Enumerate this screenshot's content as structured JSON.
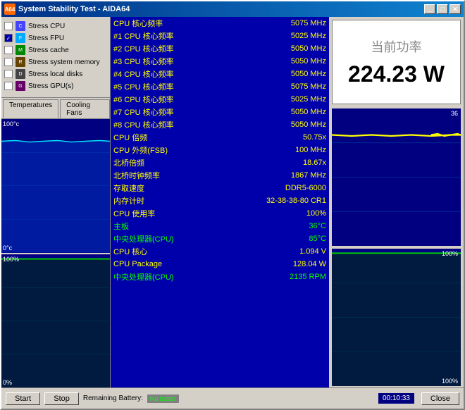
{
  "window": {
    "title": "System Stability Test - AIDA64",
    "icon": "A64"
  },
  "stress_options": [
    {
      "label": "Stress CPU",
      "checked": false,
      "icon": "cpu"
    },
    {
      "label": "Stress FPU",
      "checked": true,
      "icon": "fpu"
    },
    {
      "label": "Stress cache",
      "checked": false,
      "icon": "cache"
    },
    {
      "label": "Stress system memory",
      "checked": false,
      "icon": "mem"
    },
    {
      "label": "Stress local disks",
      "checked": false,
      "icon": "disk"
    },
    {
      "label": "Stress GPU(s)",
      "checked": false,
      "icon": "gpu"
    }
  ],
  "tabs": [
    {
      "label": "Temperatures",
      "active": true
    },
    {
      "label": "Cooling Fans",
      "active": false
    }
  ],
  "chart_left_top": {
    "top_label": "100°c",
    "bottom_label": "0°c"
  },
  "chart_left_bottom": {
    "top_label": "100%",
    "bottom_label": "0%"
  },
  "cpu_data": [
    {
      "label": "CPU 核心频率",
      "value": "5075 MHz",
      "style": "yellow"
    },
    {
      "label": "#1 CPU 核心频率",
      "value": "5025 MHz",
      "style": "yellow"
    },
    {
      "label": "#2 CPU 核心频率",
      "value": "5050 MHz",
      "style": "yellow"
    },
    {
      "label": "#3 CPU 核心频率",
      "value": "5050 MHz",
      "style": "yellow"
    },
    {
      "label": "#4 CPU 核心频率",
      "value": "5050 MHz",
      "style": "yellow"
    },
    {
      "label": "#5 CPU 核心频率",
      "value": "5075 MHz",
      "style": "yellow"
    },
    {
      "label": "#6 CPU 核心频率",
      "value": "5025 MHz",
      "style": "yellow"
    },
    {
      "label": "#7 CPU 核心频率",
      "value": "5050 MHz",
      "style": "yellow"
    },
    {
      "label": "#8 CPU 核心频率",
      "value": "5050 MHz",
      "style": "yellow"
    },
    {
      "label": "CPU 倍频",
      "value": "50.75x",
      "style": "yellow"
    },
    {
      "label": "CPU 外频(FSB)",
      "value": "100 MHz",
      "style": "yellow"
    },
    {
      "label": "北桥倍频",
      "value": "18.67x",
      "style": "yellow"
    },
    {
      "label": "北桥时钟频率",
      "value": "1867 MHz",
      "style": "yellow"
    },
    {
      "label": "存取速度",
      "value": "DDR5-6000",
      "style": "yellow"
    },
    {
      "label": "内存计时",
      "value": "32-38-38-80 CR1",
      "style": "yellow"
    },
    {
      "label": "CPU 使用率",
      "value": "100%",
      "style": "yellow"
    },
    {
      "label": "主板",
      "value": "36°C",
      "style": "green"
    },
    {
      "label": "中央处理器(CPU)",
      "value": "85°C",
      "style": "green"
    },
    {
      "label": "CPU 核心",
      "value": "1.094 V",
      "style": "yellow"
    },
    {
      "label": "CPU Package",
      "value": "128.04 W",
      "style": "yellow"
    },
    {
      "label": "中央处理器(CPU)",
      "value": "2135 RPM",
      "style": "green"
    }
  ],
  "power": {
    "label": "当前功率",
    "value": "224.23 W"
  },
  "right_charts": [
    {
      "top_label": "36",
      "bottom_label": ""
    },
    {
      "top_label": "100%",
      "bottom_label": "100%"
    }
  ],
  "bottom": {
    "battery_label": "Remaining Battery:",
    "battery_status": "No batter",
    "time": "00:10:33",
    "start_label": "Start",
    "stop_label": "Stop",
    "close_label": "Close"
  }
}
